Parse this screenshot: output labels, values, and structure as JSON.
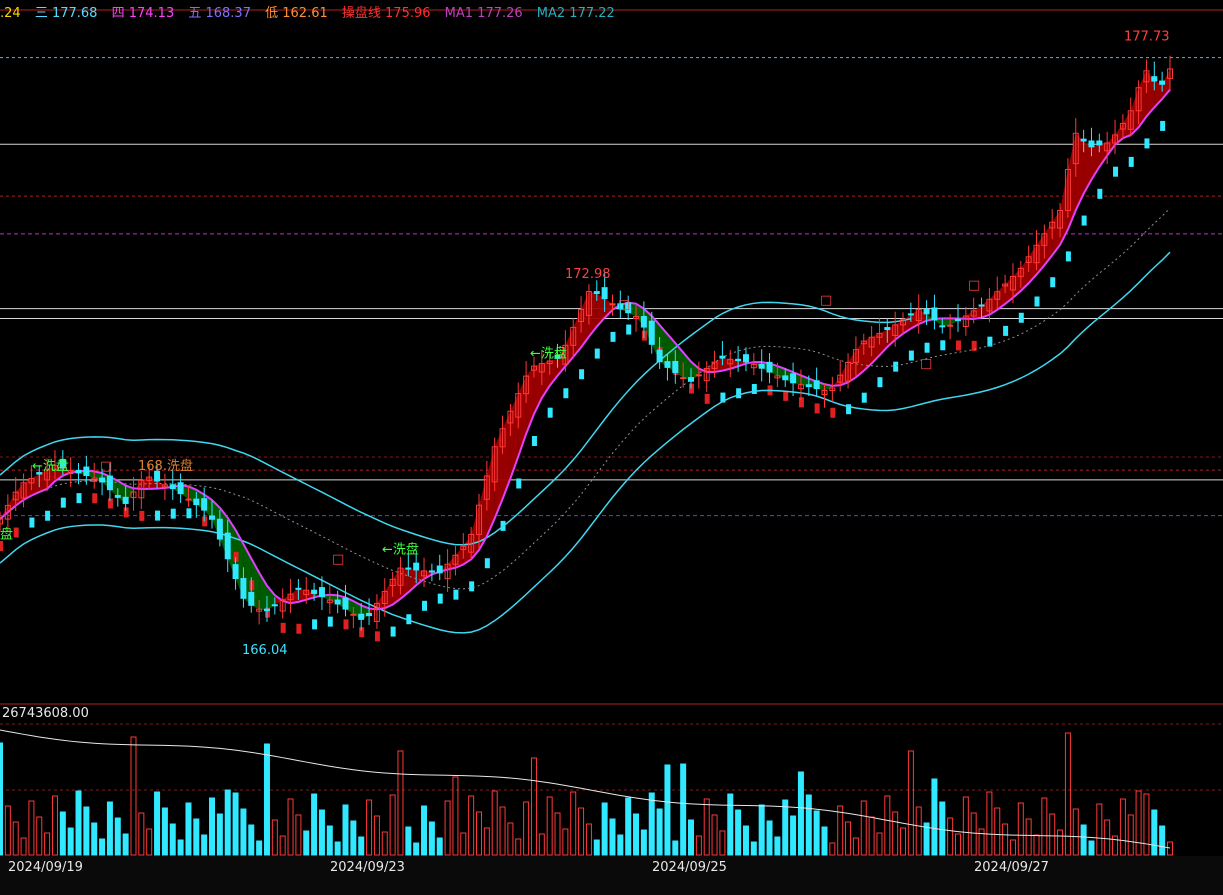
{
  "legend": [
    {
      "label": ".24",
      "color": "#ffd400"
    },
    {
      "label": "三 177.68",
      "color": "#4fe0ff"
    },
    {
      "label": "四 174.13",
      "color": "#ff40ff"
    },
    {
      "label": "五 168.37",
      "color": "#8070ff"
    },
    {
      "label": "低 162.61",
      "color": "#ff9030"
    },
    {
      "label": "操盘线 175.96",
      "color": "#ff3030"
    },
    {
      "label": "MA1 177.26",
      "color": "#c040c0"
    },
    {
      "label": "MA2 177.22",
      "color": "#20b0c0"
    }
  ],
  "volume_readout": "26743608.00",
  "dates": [
    {
      "label": "2024/09/19"
    },
    {
      "label": "2024/09/23"
    },
    {
      "label": "2024/09/25"
    },
    {
      "label": "2024/09/27"
    }
  ],
  "colors": {
    "up": "#ff3838",
    "down": "#30e8ff",
    "band_up": "#a00000",
    "band_down": "#006000",
    "channel": "#40d8f0",
    "wash": "#40ff40"
  },
  "chart_data": {
    "type": "candlestick",
    "price_range": [
      164.5,
      178.5
    ],
    "high_label": "177.73",
    "low_label": "166.04",
    "mid_high_label": "172.98",
    "reference_levels": [
      177.73,
      175.96,
      174.9,
      174.13,
      172.6,
      172.4,
      169.3,
      169.1,
      168.37
    ],
    "annotations": [
      {
        "text": "←洗盘",
        "value": 169.3
      },
      {
        "text": "168.洗盘",
        "value": 169.3
      },
      {
        "text": "盘",
        "value": 167.9
      },
      {
        "text": "←洗盘",
        "value": 167.6
      },
      {
        "text": "←洗盘",
        "value": 171.6
      },
      {
        "text": "□",
        "value": 169.3
      },
      {
        "text": "□",
        "value": 167.4
      },
      {
        "text": "□",
        "value": 172.6
      },
      {
        "text": "□",
        "value": 171.4
      },
      {
        "text": "□",
        "value": 172.7
      },
      {
        "text": "□",
        "value": 173.0
      }
    ]
  }
}
